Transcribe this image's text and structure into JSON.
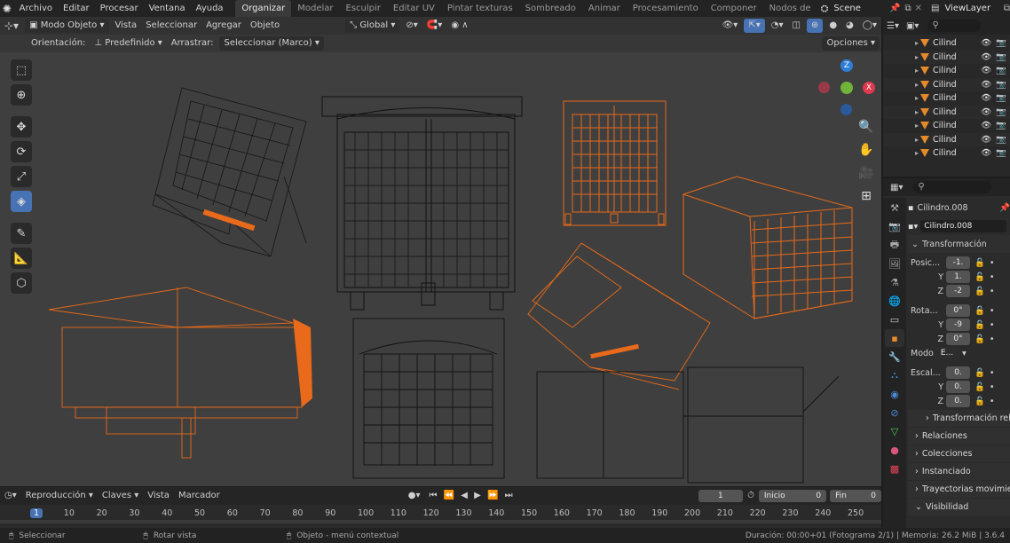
{
  "menu": {
    "items": [
      "Archivo",
      "Editar",
      "Procesar",
      "Ventana",
      "Ayuda"
    ],
    "workspaces": [
      "Organizar",
      "Modelar",
      "Esculpir",
      "Editar UV",
      "Pintar texturas",
      "Sombreado",
      "Animar",
      "Procesamiento",
      "Componer",
      "Nodos de"
    ],
    "active_workspace": "Organizar",
    "scene": "Scene",
    "view_layer": "ViewLayer"
  },
  "viewport_header": {
    "mode": "Modo Objeto",
    "menus": [
      "Vista",
      "Seleccionar",
      "Agregar",
      "Objeto"
    ],
    "transform_orientation": "Global",
    "orientation_label": "Orientación:",
    "orientation_value": "Predefinido",
    "drag_label": "Arrastrar:",
    "drag_value": "Seleccionar (Marco)",
    "options": "Opciones"
  },
  "gizmo": {
    "z": "Z",
    "x": "X",
    "y": "Y"
  },
  "outliner": {
    "items": [
      "Cilind",
      "Cilind",
      "Cilind",
      "Cilind",
      "Cilind",
      "Cilind",
      "Cilind",
      "Cilind",
      "Cilind"
    ]
  },
  "properties": {
    "object_name": "Cilindro.008",
    "data_name": "Cilindro.008",
    "transform_title": "Transformación",
    "location_label": "Posic...",
    "location": {
      "x": "-1.",
      "y": "1.",
      "z": "-2"
    },
    "rotation_label": "Rota...",
    "rotation": {
      "x": "0°",
      "y": "-9",
      "z": "0°"
    },
    "mode_label": "Modo",
    "mode_value": "E...",
    "scale_label": "Escal...",
    "scale": {
      "x": "0.",
      "y": "0.",
      "z": "0."
    },
    "axis_y": "Y",
    "axis_z": "Z",
    "sections": [
      "Transformación rel",
      "Relaciones",
      "Colecciones",
      "Instanciado",
      "Trayectorias movimie",
      "Visibilidad"
    ]
  },
  "timeline": {
    "menus": [
      "Reproducción",
      "Claves",
      "Vista",
      "Marcador"
    ],
    "current_frame": "1",
    "start_label": "Inicio",
    "start_value": "0",
    "end_label": "Fin",
    "end_value": "0",
    "ticks": [
      "1",
      "10",
      "20",
      "30",
      "40",
      "50",
      "60",
      "70",
      "80",
      "90",
      "100",
      "110",
      "120",
      "130",
      "140",
      "150",
      "160",
      "170",
      "180",
      "190",
      "200",
      "210",
      "220",
      "230",
      "240",
      "250"
    ]
  },
  "status": {
    "select": "Seleccionar",
    "rotate": "Rotar vista",
    "context": "Objeto - menú contextual",
    "info": "Duración: 00:00+01 (Fotograma 2/1) | Memoria: 26.2 MiB | 3.6.4"
  },
  "colors": {
    "accent": "#4772b3",
    "selected": "#e86a1a",
    "wire": "#111111"
  }
}
